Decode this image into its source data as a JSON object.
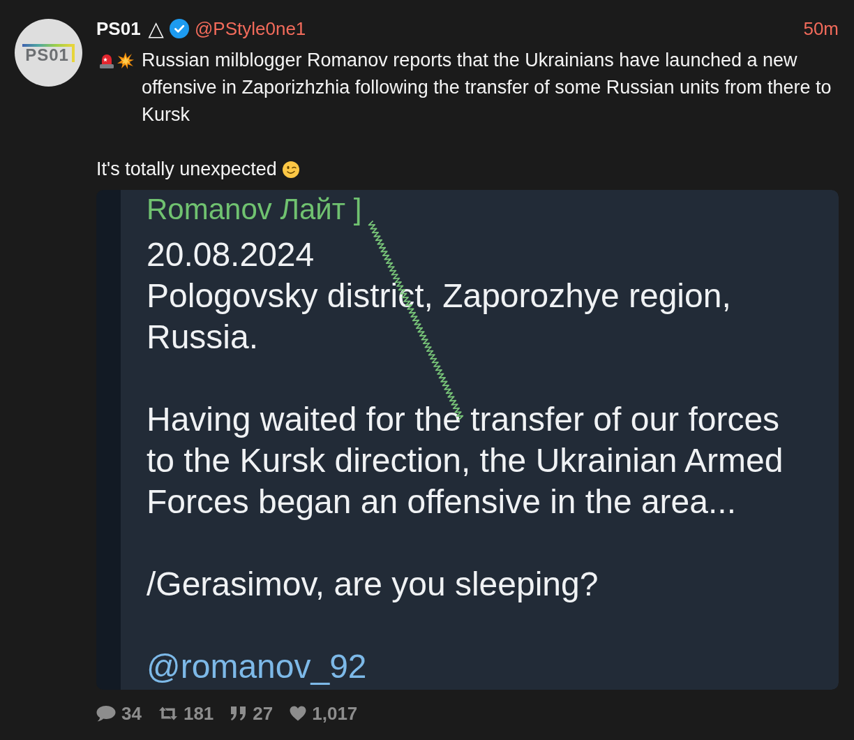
{
  "post": {
    "avatar": {
      "logo_text": "PS01"
    },
    "author": {
      "name": "PS01",
      "symbol": "△",
      "verified": true,
      "handle": "@PStyle0ne1"
    },
    "time": "50m",
    "paragraphs": [
      {
        "kind": "alert",
        "text": "Russian milblogger Romanov reports that the Ukrainians have launched a new offensive in Zaporizhzhia following the transfer of some Russian units from there to Kursk"
      },
      {
        "kind": "wink",
        "text": "It's totally unexpected"
      }
    ],
    "embedded_screenshot": {
      "sender": "Romanov Лайт ]",
      "message": [
        {
          "kind": "date",
          "text": "20.08.2024"
        },
        {
          "kind": "location",
          "text": "Pologovsky district, Zaporozhye region, Russia."
        },
        {
          "kind": "body",
          "text": "Having waited for the transfer of our forces to the Kursk direction, the Ukrainian Armed Forces began an offensive in the area..."
        },
        {
          "kind": "body",
          "text": "/Gerasimov, are you sleeping?"
        },
        {
          "kind": "mention",
          "text": "@romanov_92"
        }
      ]
    },
    "stats": [
      {
        "kind": "replies",
        "count": "34"
      },
      {
        "kind": "reposts",
        "count": "181"
      },
      {
        "kind": "quotes",
        "count": "27"
      },
      {
        "kind": "likes",
        "count": "1,017"
      }
    ]
  }
}
